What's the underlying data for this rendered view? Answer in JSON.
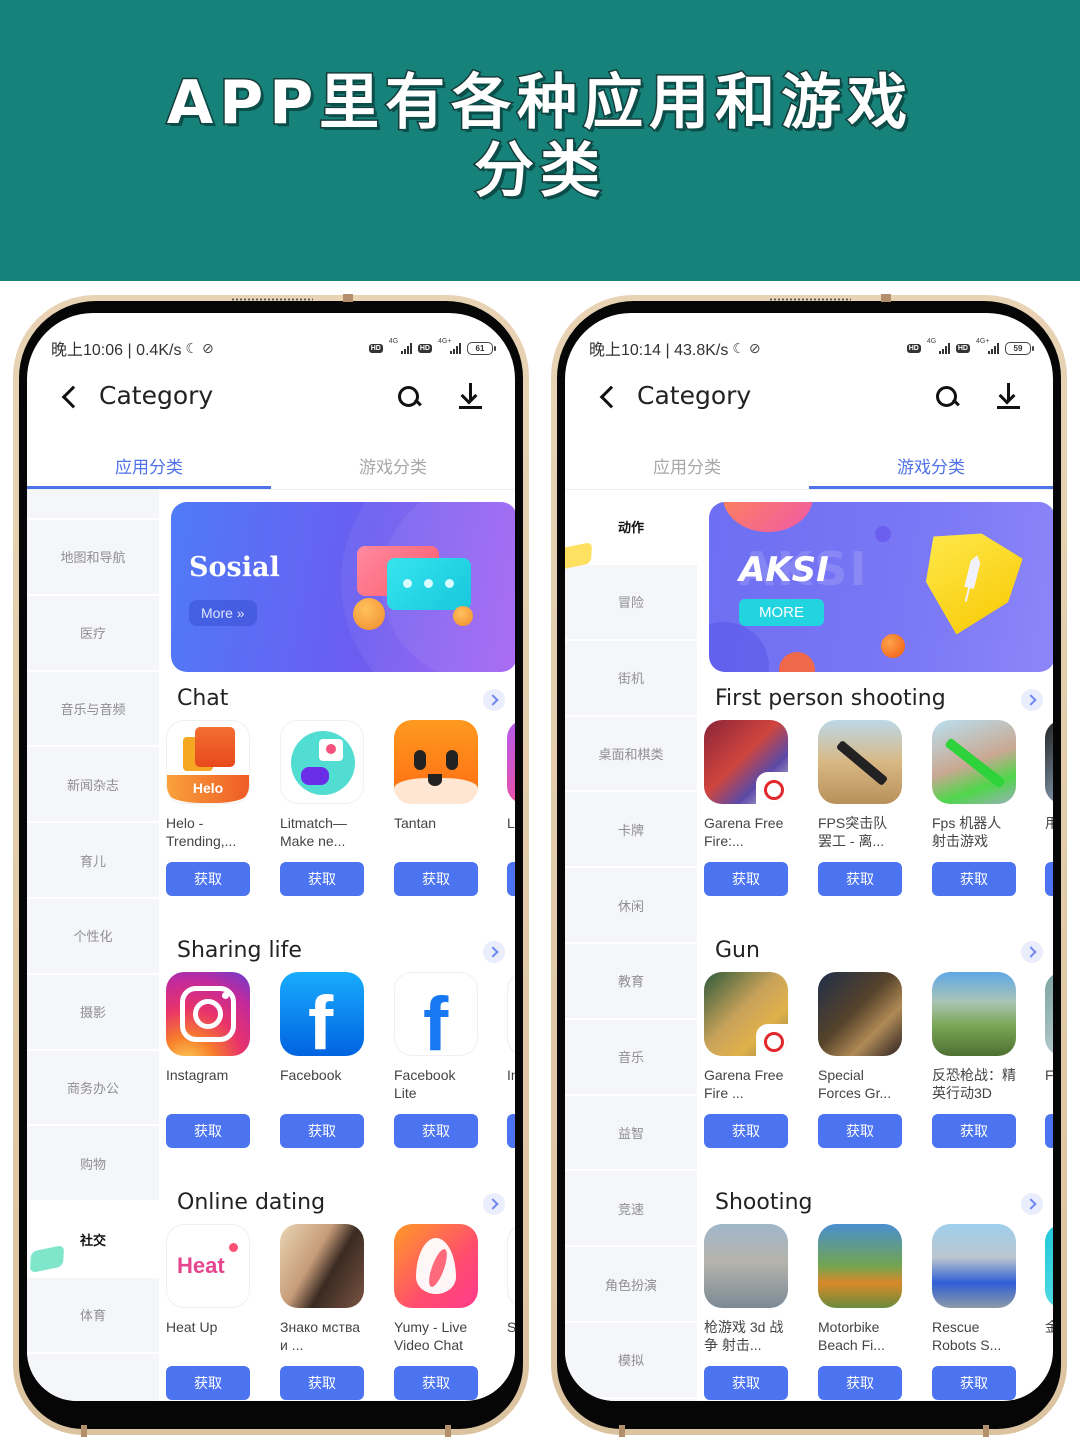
{
  "banner": {
    "line1": "APP里有各种应用和游戏",
    "line2": "分类",
    "background": "#17827a"
  },
  "phones": [
    {
      "status": {
        "time_speed": "晚上10:06 | 0.4K/s",
        "network1": "4G",
        "network2": "4G+",
        "battery": "61"
      },
      "appbar": {
        "title": "Category"
      },
      "tabs": [
        {
          "label": "应用分类",
          "active": true
        },
        {
          "label": "游戏分类",
          "active": false
        }
      ],
      "sidebar": [
        {
          "label": ""
        },
        {
          "label": "地图和导航"
        },
        {
          "label": "医疗"
        },
        {
          "label": "音乐与音频"
        },
        {
          "label": "新闻杂志"
        },
        {
          "label": "育儿"
        },
        {
          "label": "个性化"
        },
        {
          "label": "摄影"
        },
        {
          "label": "商务办公"
        },
        {
          "label": "购物"
        },
        {
          "label": "社交",
          "active": true
        },
        {
          "label": "体育"
        }
      ],
      "hero": {
        "title": "Sosial",
        "more_label": "More  »"
      },
      "sections": [
        {
          "title": "Chat",
          "apps": [
            {
              "name": "Helo - Trending,...",
              "icon": "helo-app-icon",
              "button": "获取"
            },
            {
              "name": "Litmatch—Make ne...",
              "icon": "litmatch-app-icon",
              "button": "获取"
            },
            {
              "name": "Tantan",
              "icon": "tantan-app-icon",
              "button": "获取"
            }
          ],
          "partial": {
            "name": "Lik Sh"
          }
        },
        {
          "title": "Sharing life",
          "apps": [
            {
              "name": "Instagram",
              "icon": "instagram-app-icon",
              "button": "获取"
            },
            {
              "name": "Facebook",
              "icon": "facebook-app-icon",
              "button": "获取"
            },
            {
              "name": "Facebook Lite",
              "icon": "facebook-lite-app-icon",
              "button": "获取"
            }
          ],
          "partial": {
            "name": "Ins Lit"
          }
        },
        {
          "title": "Online dating",
          "apps": [
            {
              "name": "Heat Up",
              "icon": "heat-up-app-icon",
              "icon_text": "Heat",
              "button": "获取"
            },
            {
              "name": "Знако мства и ...",
              "icon": "znakomstva-app-icon",
              "button": "获取"
            },
            {
              "name": "Yumy - Live Video Chat",
              "icon": "yumy-app-icon",
              "button": "获取"
            }
          ],
          "partial": {
            "name": "Sk"
          }
        }
      ]
    },
    {
      "status": {
        "time_speed": "晚上10:14 | 43.8K/s",
        "network1": "4G",
        "network2": "4G+",
        "battery": "59"
      },
      "appbar": {
        "title": "Category"
      },
      "tabs": [
        {
          "label": "应用分类",
          "active": false
        },
        {
          "label": "游戏分类",
          "active": true
        }
      ],
      "sidebar": [
        {
          "label": "动作",
          "active": true
        },
        {
          "label": "冒险"
        },
        {
          "label": "街机"
        },
        {
          "label": "桌面和棋类"
        },
        {
          "label": "卡牌"
        },
        {
          "label": "休闲"
        },
        {
          "label": "教育"
        },
        {
          "label": "音乐"
        },
        {
          "label": "益智"
        },
        {
          "label": "竞速"
        },
        {
          "label": "角色扮演"
        },
        {
          "label": "模拟"
        }
      ],
      "hero": {
        "title": "AKSI",
        "ghost": "AKSI",
        "more_label": "MORE"
      },
      "sections": [
        {
          "title": "First person shooting",
          "apps": [
            {
              "name": "Garena Free Fire:...",
              "icon": "garena-free-fire-game-icon",
              "button": "获取"
            },
            {
              "name": "FPS突击队 罢工 - 离...",
              "icon": "fps-commando-game-icon",
              "button": "获取"
            },
            {
              "name": "Fps 机器人 射击游戏",
              "icon": "fps-robot-game-icon",
              "button": "获取"
            }
          ],
          "partial": {
            "name": "用 射"
          }
        },
        {
          "title": "Gun",
          "apps": [
            {
              "name": "Garena Free Fire ...",
              "icon": "garena-free-fire-max-game-icon",
              "button": "获取"
            },
            {
              "name": "Special Forces Gr...",
              "icon": "special-forces-group-game-icon",
              "button": "获取"
            },
            {
              "name": "反恐枪战：精英行动3D",
              "icon": "counter-terror-game-icon",
              "button": "获取"
            }
          ],
          "partial": {
            "name": "Fi 戏"
          }
        },
        {
          "title": "Shooting",
          "apps": [
            {
              "name": "枪游戏 3d 战争 射击...",
              "icon": "gun-game-3d-icon",
              "button": "获取"
            },
            {
              "name": "Motorbike Beach Fi...",
              "icon": "motorbike-beach-game-icon",
              "button": "获取"
            },
            {
              "name": "Rescue Robots S...",
              "icon": "rescue-robots-game-icon",
              "button": "获取"
            }
          ],
          "partial": {
            "name": "金"
          }
        }
      ]
    }
  ]
}
